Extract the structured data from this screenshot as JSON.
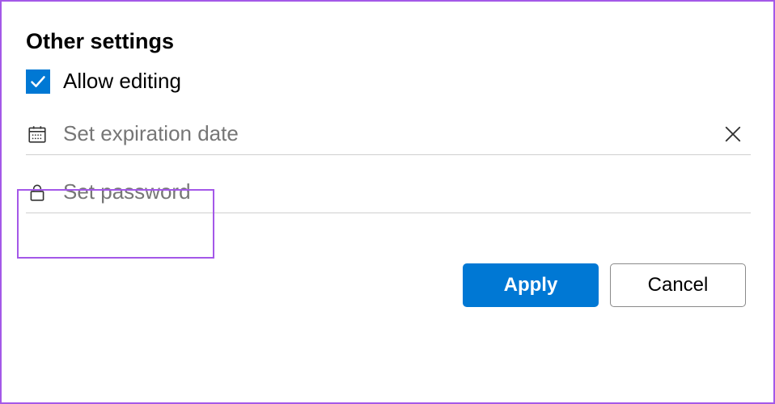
{
  "section": {
    "title": "Other settings"
  },
  "allow_editing": {
    "label": "Allow editing",
    "checked": true
  },
  "expiration": {
    "placeholder": "Set expiration date",
    "value": ""
  },
  "password": {
    "placeholder": "Set password",
    "value": ""
  },
  "buttons": {
    "apply": "Apply",
    "cancel": "Cancel"
  }
}
